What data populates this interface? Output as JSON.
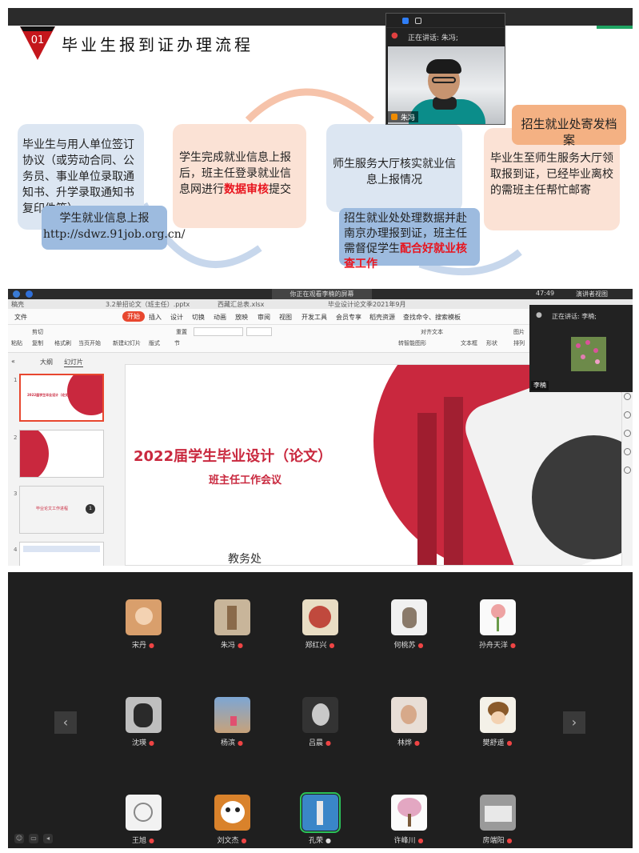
{
  "panel1": {
    "badge_number": "01",
    "title": "毕业生报到证办理流程",
    "step1": {
      "text": "毕业生与用人单位签订协议（或劳动合同、公务员、事业单位录取通知书、升学录取通知书复印件等）"
    },
    "step1_note": {
      "line1": "学生就业信息上报",
      "line2": "http://sdwz.91job.org.cn/"
    },
    "step2": {
      "before": "学生完成就业信息上报后，班主任登录就业信息网进行",
      "highlight": "数据审核",
      "after": "提交"
    },
    "step3": {
      "text": "师生服务大厅核实就业信息上报情况"
    },
    "step3_note": {
      "before": "招生就业处处理数据并赴南京办理报到证，班主任需督促学生",
      "highlight": "配合好就业核查工作"
    },
    "step4_header": "招生就业处寄发档案",
    "step4": {
      "text": "毕业生至师生服务大厅领取报到证，已经毕业离校的需班主任帮忙邮寄"
    },
    "video": {
      "speaking_label": "正在讲话: 朱冯;",
      "name": "朱冯"
    },
    "colors": {
      "blue_box": "#dce6f2",
      "peach_box": "#fbe2d5",
      "highlight": "#e8141e"
    }
  },
  "panel2": {
    "share_notice": "你正在观看李楠的屏幕",
    "clock": "47:49",
    "presenter_view": "演讲者视图",
    "file_tabs": [
      "稿壳",
      "3.2单招论文（班主任）.pptx",
      "西藏汇总表.xlsx",
      "毕业设计论文季2021年9月"
    ],
    "menu": [
      "文件",
      "开始",
      "插入",
      "设计",
      "切换",
      "动画",
      "放映",
      "审阅",
      "视图",
      "开发工具",
      "会员专享",
      "稻壳资源"
    ],
    "search_placeholder": "查找命令、搜索模板",
    "ribbon": [
      "剪切",
      "复制",
      "格式刷",
      "粘贴",
      "当页开始",
      "新建幻灯片",
      "版式",
      "节",
      "重置",
      "文本框",
      "形状",
      "排列",
      "图片",
      "对齐文本",
      "转智能图形"
    ],
    "sidebar_tabs": [
      "大纲",
      "幻灯片"
    ],
    "slide_numbers": [
      "1",
      "2",
      "3",
      "4"
    ],
    "thumb3_text": "毕业论文工作进程",
    "slide": {
      "title": "2022届学生毕业设计（论文）",
      "subtitle": "班主任工作会议",
      "department": "教务处"
    },
    "video": {
      "speaking_label": "正在讲话: 李楠;",
      "name": "李楠"
    }
  },
  "panel3": {
    "participants": [
      {
        "name": "宋丹",
        "avatar": "cartoon-avatar"
      },
      {
        "name": "朱冯",
        "avatar": "photo-avatar"
      },
      {
        "name": "郑红兴",
        "avatar": "flower-avatar"
      },
      {
        "name": "何桃苏",
        "avatar": "bear-avatar"
      },
      {
        "name": "孙舟天洋",
        "avatar": "flower-avatar"
      },
      {
        "name": "沈瑛",
        "avatar": "photo-avatar"
      },
      {
        "name": "杨滨",
        "avatar": "photo-avatar"
      },
      {
        "name": "吕晨",
        "avatar": "photo-avatar"
      },
      {
        "name": "林烨",
        "avatar": "photo-avatar"
      },
      {
        "name": "樊舒遥",
        "avatar": "cartoon-avatar"
      },
      {
        "name": "王旭",
        "avatar": "sketch-avatar"
      },
      {
        "name": "刘文杰",
        "avatar": "panda-avatar"
      },
      {
        "name": "孔荣",
        "avatar": "photo-avatar"
      },
      {
        "name": "许峰川",
        "avatar": "tree-avatar"
      },
      {
        "name": "房端阳",
        "avatar": "photo-avatar"
      }
    ],
    "prev_icon": "chevron-left-icon",
    "next_icon": "chevron-right-icon",
    "active_speaker_color": "#2bc25a"
  }
}
